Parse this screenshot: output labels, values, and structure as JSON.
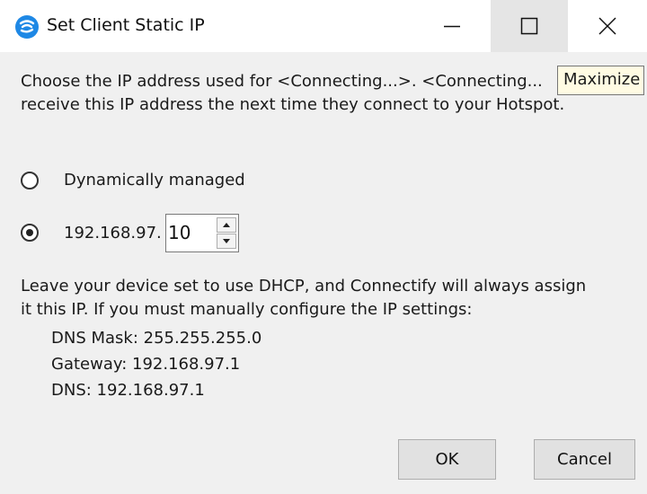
{
  "window": {
    "title": "Set Client Static IP",
    "icon": "connectify-hotspot-icon"
  },
  "titlebar_buttons": {
    "minimize": "minimize-icon",
    "maximize": "maximize-icon",
    "close": "close-icon"
  },
  "tooltip": "Maximize",
  "description": {
    "line1": "Choose the IP address used for <Connecting...>. <Connecting...",
    "line2": "receive this IP address the next time they connect to your Hotspot."
  },
  "options": {
    "dynamic_label": "Dynamically managed",
    "static_prefix": "192.168.97.",
    "selected": "static"
  },
  "octet": {
    "value": "10"
  },
  "info": {
    "line1": "Leave your device set to use DHCP, and Connectify will always assign",
    "line2": "it this IP.  If you must  manually configure the IP settings:"
  },
  "details": {
    "dns_mask": "DNS Mask: 255.255.255.0",
    "gateway": "Gateway: 192.168.97.1",
    "dns": "DNS: 192.168.97.1"
  },
  "buttons": {
    "ok": "OK",
    "cancel": "Cancel"
  },
  "colors": {
    "accent": "#1e88e5",
    "window_bg": "#f0f0f0",
    "titlebar_bg": "#ffffff",
    "tooltip_bg": "#fffbe3"
  }
}
